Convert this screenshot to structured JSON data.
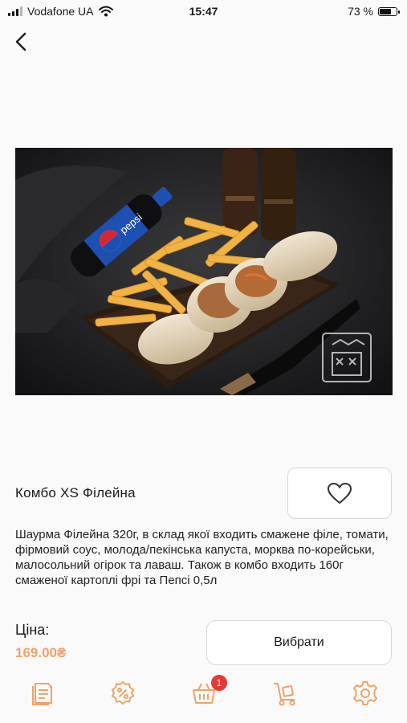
{
  "status_bar": {
    "carrier": "Vodafone UA",
    "time": "15:47",
    "battery_percent": "73 %",
    "battery_level": 0.73
  },
  "product": {
    "title": "Комбо XS Філейна",
    "description": "Шаурма Філейна 320г, в склад якої входить смажене філе, томати, фірмовий соус, молода/пекінська капуста, морква по-корейськи, малосольний огірок та лаваш. Також в  комбо входить 160г смаженої картоплі фрі та Пепсі 0,5л",
    "price_label": "Ціна:",
    "price": "169.00₴",
    "choose_button": "Вибрати",
    "bottle_label": "pepsi"
  },
  "bottom_nav": {
    "items": [
      "menu-icon",
      "discount-icon",
      "cart-icon",
      "delivery-icon",
      "settings-icon"
    ],
    "cart_badge": "1"
  },
  "colors": {
    "accent": "#f0a268",
    "badge": "#e53935",
    "background": "#fafafa"
  }
}
